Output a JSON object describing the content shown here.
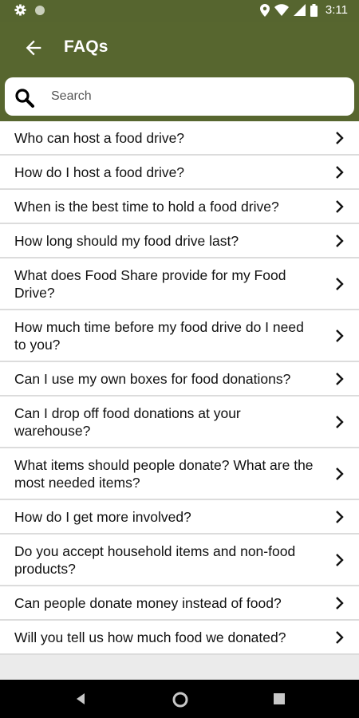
{
  "status_bar": {
    "time": "3:11",
    "icons": [
      "gear-icon",
      "circle-icon",
      "location-icon",
      "wifi-icon",
      "signal-icon",
      "battery-icon"
    ]
  },
  "header": {
    "title": "FAQs",
    "back_icon": "arrow-left-icon"
  },
  "search": {
    "placeholder": "Search",
    "value": ""
  },
  "faqs": [
    {
      "question": "Who can host a food drive?"
    },
    {
      "question": "How do I host a food drive?"
    },
    {
      "question": "When is the best time to hold a food drive?"
    },
    {
      "question": "How long should my food drive last?"
    },
    {
      "question": "What does Food Share provide for my Food Drive?"
    },
    {
      "question": "How much time before my food drive do I need to you?"
    },
    {
      "question": "Can I use my own boxes for food donations?"
    },
    {
      "question": "Can I drop off food donations at your warehouse?"
    },
    {
      "question": "What items should people donate? What are the most needed items?"
    },
    {
      "question": "How do I get more involved?"
    },
    {
      "question": "Do you accept household items and non-food products?"
    },
    {
      "question": "Can people donate money instead of food?"
    },
    {
      "question": "Will you tell us how much food we donated?"
    }
  ],
  "colors": {
    "brand": "#57662f",
    "background": "#ebebeb",
    "divider": "#dcdcdc"
  }
}
